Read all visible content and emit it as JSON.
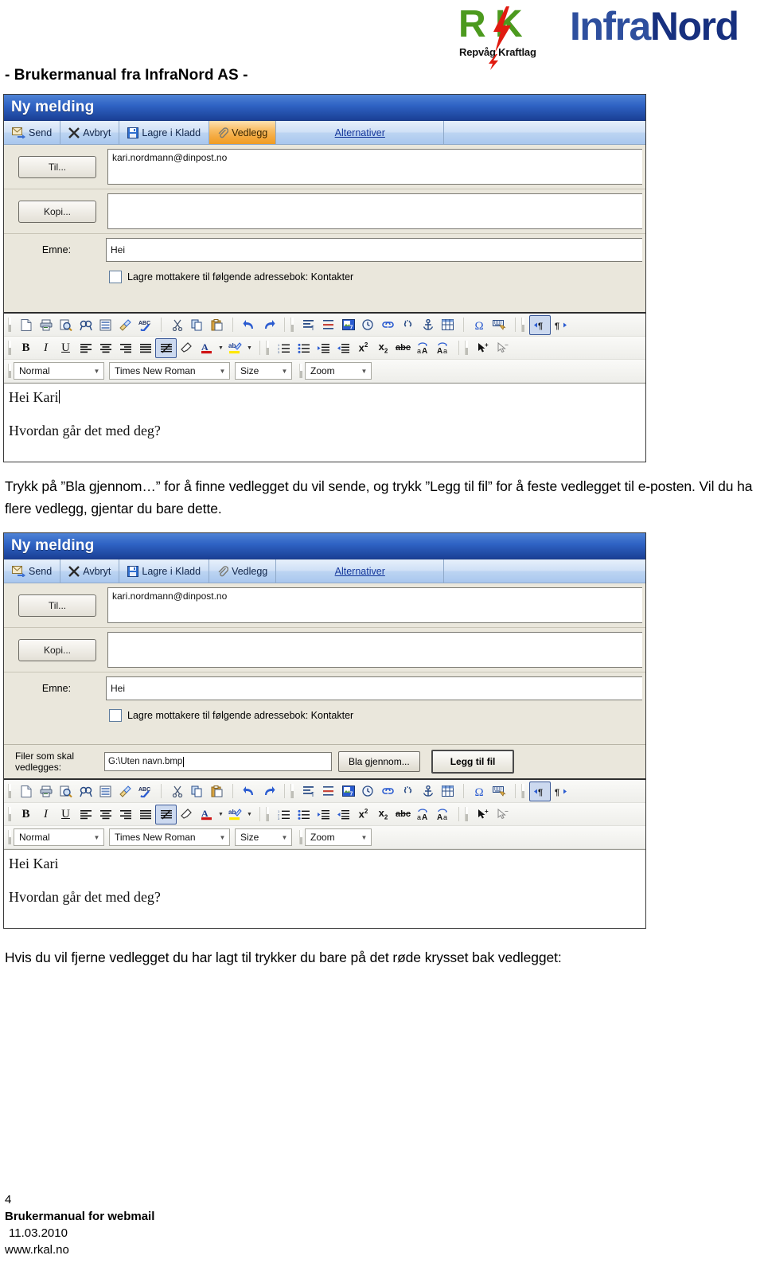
{
  "document": {
    "subtitle": "- Brukermanual fra InfraNord AS -",
    "logo": {
      "mark": "R K",
      "mark_left": "R",
      "mark_right": "K",
      "tagline": "Repvåg Kraftlag",
      "brand_first": "Infra",
      "brand_second": "Nord",
      "green": "#4c9a1e",
      "red": "#e01b10",
      "blue_light": "#2e4f9e",
      "blue_dark": "#17307f"
    }
  },
  "window1": {
    "title": "Ny melding",
    "commands": [
      {
        "label": "Send",
        "icon": "send-mail-icon",
        "active": false
      },
      {
        "label": "Avbryt",
        "icon": "cancel-x-icon",
        "active": false
      },
      {
        "label": "Lagre i Kladd",
        "icon": "save-floppy-icon",
        "active": false
      },
      {
        "label": "Vedlegg",
        "icon": "paperclip-icon",
        "active": true
      },
      {
        "label": "Alternativer",
        "icon": "link-text",
        "active": false
      }
    ],
    "fields": {
      "to_button": "Til...",
      "to_value": "kari.nordmann@dinpost.no",
      "cc_button": "Kopi...",
      "cc_value": "",
      "subject_label": "Emne:",
      "subject_value": "Hei",
      "save_recipients_label": "Lagre mottakere til følgende adressebok: Kontakter",
      "save_recipients_checked": false
    },
    "editor": {
      "style_select": "Normal",
      "font_select": "Times New Roman",
      "size_select": "Size",
      "zoom_select": "Zoom",
      "body_line1": "Hei Kari",
      "body_line2": "Hvordan går det med deg?",
      "caret_after_line1": true
    }
  },
  "window2": {
    "title": "Ny melding",
    "commands": [
      {
        "label": "Send",
        "icon": "send-mail-icon",
        "active": false
      },
      {
        "label": "Avbryt",
        "icon": "cancel-x-icon",
        "active": false
      },
      {
        "label": "Lagre i Kladd",
        "icon": "save-floppy-icon",
        "active": false
      },
      {
        "label": "Vedlegg",
        "icon": "paperclip-icon",
        "active": false
      },
      {
        "label": "Alternativer",
        "icon": "link-text",
        "active": false
      }
    ],
    "fields": {
      "to_button": "Til...",
      "to_value": "kari.nordmann@dinpost.no",
      "cc_button": "Kopi...",
      "cc_value": "",
      "subject_label": "Emne:",
      "subject_value": "Hei",
      "save_recipients_label": "Lagre mottakere til følgende adressebok: Kontakter",
      "save_recipients_checked": false
    },
    "attachment": {
      "label_line1": "Filer som skal",
      "label_line2": "vedlegges:",
      "path_value": "G:\\Uten navn.bmp",
      "browse_button": "Bla gjennom...",
      "add_button": "Legg til fil"
    },
    "editor": {
      "style_select": "Normal",
      "font_select": "Times New Roman",
      "size_select": "Size",
      "zoom_select": "Zoom",
      "body_line1": "Hei Kari",
      "body_line2": "Hvordan går det med deg?",
      "caret_after_line1": false
    }
  },
  "toolbar_icons": {
    "row1": [
      "new-document-icon",
      "print-icon",
      "print-preview-icon",
      "find-icon",
      "page-properties-icon",
      "paintbrush-icon",
      "spellcheck-abc-icon",
      "cut-scissors-icon",
      "copy-icon",
      "paste-icon",
      "undo-icon",
      "redo-icon",
      "paragraph-format-icon",
      "horizontal-rule-icon",
      "insert-image-icon",
      "insert-time-icon",
      "insert-link-icon",
      "remove-link-icon",
      "anchor-icon",
      "insert-table-icon",
      "special-character-omega-icon",
      "keyboard-icon",
      "ltr-direction-icon",
      "rtl-direction-icon"
    ],
    "row2": [
      "bold-icon",
      "italic-icon",
      "underline-icon",
      "align-left-icon",
      "align-center-icon",
      "align-right-icon",
      "align-justify-icon",
      "remove-format-icon",
      "eraser-icon",
      "font-color-icon",
      "font-color-dropdown-icon",
      "highlight-color-icon",
      "highlight-color-dropdown-icon",
      "ordered-list-icon",
      "unordered-list-icon",
      "indent-increase-icon",
      "indent-decrease-icon",
      "superscript-icon",
      "subscript-icon",
      "strikethrough-icon",
      "uppercase-icon",
      "lowercase-icon",
      "select-all-icon",
      "select-none-icon"
    ]
  },
  "paragraphs": {
    "p1": "Trykk på ”Bla gjennom…” for å finne vedlegget du vil sende, og trykk ”Legg til fil” for å feste vedlegget til e-posten. Vil du ha flere vedlegg, gjentar du bare dette.",
    "p2": "Hvis du vil fjerne vedlegget du har lagt til trykker du bare på det røde krysset bak vedlegget:"
  },
  "footer": {
    "page_number": "4",
    "title": "Brukermanual for webmail",
    "date": "11.03.2010",
    "website": "www.rkal.no"
  }
}
